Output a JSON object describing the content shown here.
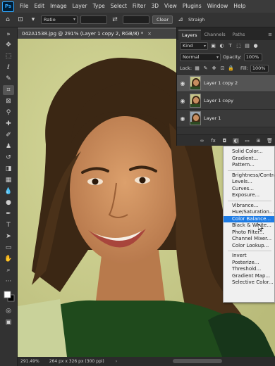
{
  "menubar": {
    "logo": "Ps",
    "items": [
      "File",
      "Edit",
      "Image",
      "Layer",
      "Type",
      "Select",
      "Filter",
      "3D",
      "View",
      "Plugins",
      "Window",
      "Help"
    ]
  },
  "options": {
    "ratio_label": "Ratio",
    "clear_label": "Clear",
    "straighten_label": "Straigh"
  },
  "document": {
    "tab_title": "042A1538.jpg @ 291% (Layer 1 copy 2, RGB/8) *",
    "close_glyph": "×"
  },
  "status": {
    "zoom": "291.49%",
    "dimensions": "264 px x 326 px (300 ppi)",
    "arrow": "›"
  },
  "layers_panel": {
    "tabs": [
      "Layers",
      "Channels",
      "Paths"
    ],
    "kind_label": "Kind",
    "blend_mode": "Normal",
    "opacity_label": "Opacity:",
    "opacity_value": "100%",
    "lock_label": "Lock:",
    "fill_label": "Fill:",
    "fill_value": "100%",
    "layers": [
      {
        "name": "Layer 1 copy 2",
        "selected": true
      },
      {
        "name": "Layer 1 copy",
        "selected": false
      },
      {
        "name": "Layer 1",
        "selected": false
      }
    ]
  },
  "adjustment_menu": {
    "groups": [
      [
        "Solid Color...",
        "Gradient...",
        "Pattern..."
      ],
      [
        "Brightness/Contrast...",
        "Levels...",
        "Curves...",
        "Exposure..."
      ],
      [
        "Vibrance...",
        "Hue/Saturation...",
        "Color Balance...",
        "Black & White...",
        "Photo Filter...",
        "Channel Mixer...",
        "Color Lookup..."
      ],
      [
        "Invert",
        "Posterize...",
        "Threshold...",
        "Gradient Map...",
        "Selective Color..."
      ]
    ],
    "highlighted": "Color Balance..."
  },
  "colors": {
    "highlight": "#1d7be4",
    "background_photo": "#c5c88a",
    "brand": "#31a8ff"
  }
}
